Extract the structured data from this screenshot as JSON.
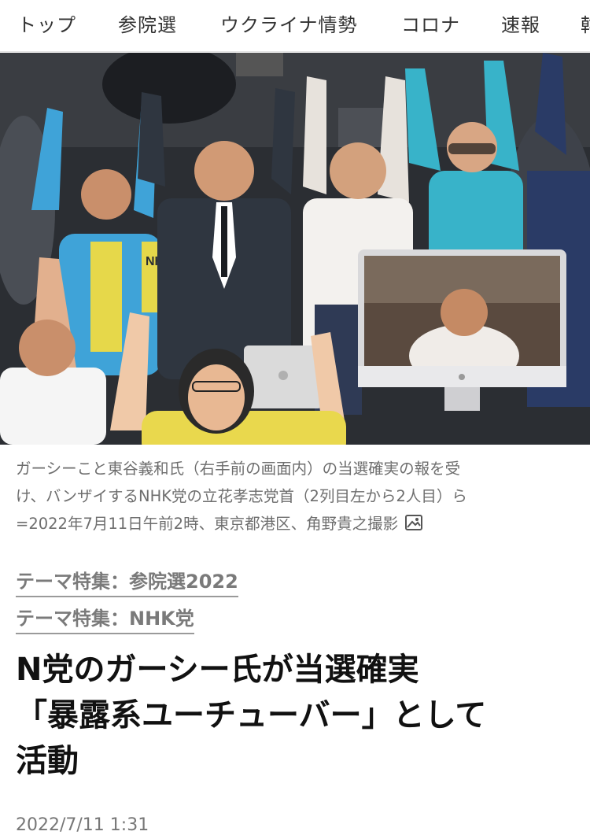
{
  "nav": {
    "items": [
      "トップ",
      "参院選",
      "ウクライナ情勢",
      "コロナ",
      "速報",
      "韓"
    ]
  },
  "photo": {
    "caption_lines": [
      "ガーシーこと東谷義和氏（右手前の画面内）の当選確実の報を受",
      "け、バンザイするNHK党の立花孝志党首（2列目左から2人目）ら",
      "=2022年7月11日午前2時、東京都港区、角野貴之撮影"
    ],
    "shirt_text": "NHK",
    "icon": "photo-gallery-icon"
  },
  "themes": [
    "テーマ特集：参院選2022",
    "テーマ特集：NHK党"
  ],
  "headline": {
    "lines": [
      "N党のガーシー氏が当選確実",
      "「暴露系ユーチューバー」として",
      "活動"
    ]
  },
  "meta": {
    "date": "2022/7/11 1:31"
  },
  "colors": {
    "nav_text": "#333333",
    "caption": "#6e6e6e",
    "theme_link": "#7a7a7a",
    "headline": "#111111",
    "shirt_yellow": "#e6d84a",
    "jacket_blue": "#3fa3d8",
    "shirt_teal": "#38b3c9"
  }
}
